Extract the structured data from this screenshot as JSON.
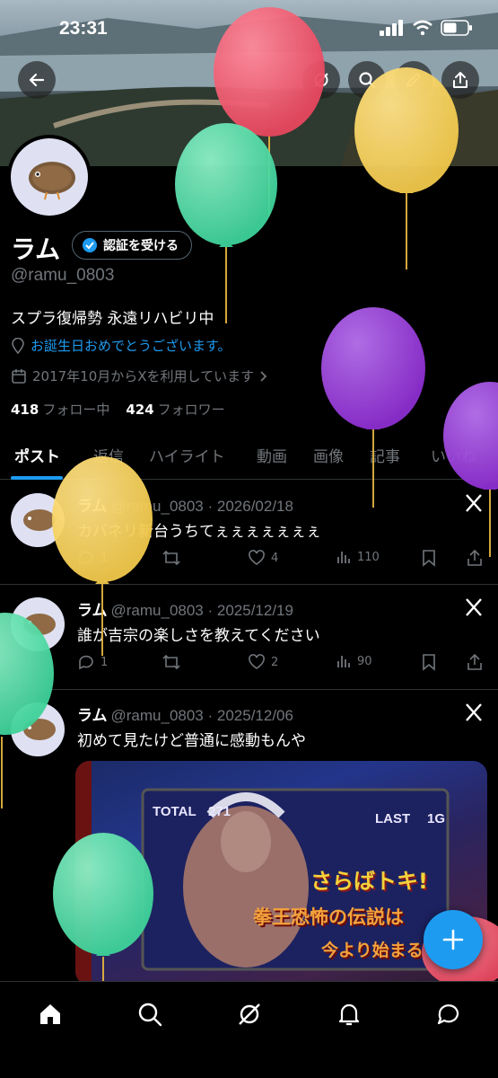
{
  "status_bar": {
    "time": "23:31"
  },
  "profile": {
    "name": "ラム",
    "verify_button": "認証を受ける",
    "handle": "@ramu_0803",
    "bio": "スプラ復帰勢 永遠リハビリ中",
    "birthday_text": "お誕生日おめでとうございます。",
    "joined_text": "2017年10月からXを利用しています",
    "following_count": "418",
    "following_label": "フォロー中",
    "followers_count": "424",
    "followers_label": "フォロワー"
  },
  "tabs": [
    "ポスト",
    "返信",
    "ハイライト",
    "動画",
    "画像",
    "記事",
    "いいね"
  ],
  "posts": [
    {
      "name": "ラム",
      "meta": "@ramu_0803 · 2026/02/18",
      "text": "カバネリ新台うちてぇぇぇぇぇぇぇ",
      "replies": "1",
      "likes": "4",
      "views": "110"
    },
    {
      "name": "ラム",
      "meta": "@ramu_0803 · 2025/12/19",
      "text": "誰が吉宗の楽しさを教えてください",
      "replies": "1",
      "likes": "2",
      "views": "90"
    },
    {
      "name": "ラム",
      "meta": "@ramu_0803 · 2025/12/06",
      "text": "初めて見たけど普通に感動もんや"
    }
  ],
  "media_texts": {
    "total_label": "TOTAL",
    "total_value": "271",
    "last_label": "LAST",
    "last_value": "1G",
    "line1": "さらばトキ!",
    "line2": "拳王恐怖の伝説は",
    "line3": "今より始まる!"
  },
  "colors": {
    "accent": "#1d9bf0",
    "balloon_red": "#e8475f",
    "balloon_yellow": "#f2c94c",
    "balloon_green": "#3fd29a",
    "balloon_purple": "#8e2fd1"
  },
  "icons": {
    "back": "back-arrow-icon",
    "grok": "grok-icon",
    "search": "search-icon",
    "edit": "edit-icon",
    "share": "share-icon",
    "compose": "plus-icon",
    "nav": [
      "home-icon",
      "search-icon",
      "grok-icon",
      "bell-icon",
      "message-icon"
    ]
  }
}
